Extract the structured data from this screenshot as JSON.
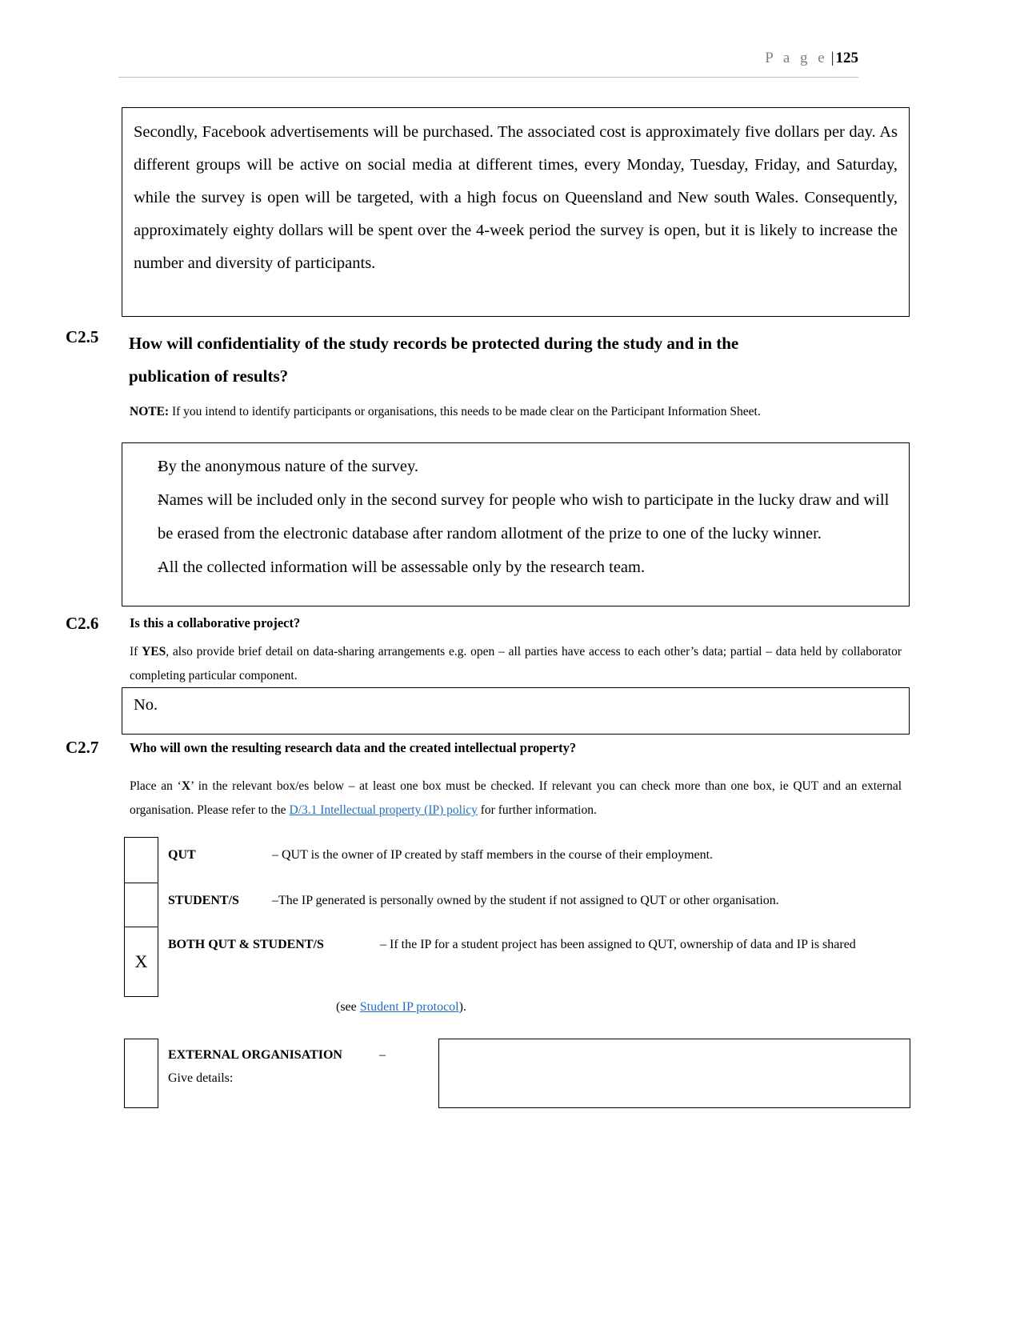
{
  "header": {
    "page_word": "P a g e",
    "separator": "|",
    "page_number": "125"
  },
  "answer_box_1": {
    "text": "Secondly, Facebook advertisements will be purchased. The associated cost is approximately five dollars per day. As different groups will be active on social media at different times, every Monday, Tuesday, Friday, and Saturday, while the survey is open will be targeted, with a high focus on Queensland and New south Wales.  Consequently, approximately eighty dollars will be spent over the 4-week period the survey is open, but it is likely to increase the number and diversity of participants."
  },
  "c25": {
    "number": "C2.5",
    "line1": "How will confidentiality of the study records be protected during the study and in the",
    "line2": "publication of results?",
    "note_label": "NOTE:",
    "note_text": " If you intend to identify participants or organisations, this needs to be made clear on the Participant Information Sheet."
  },
  "answer_box_2": {
    "bullet_mark": "-",
    "bullets": [
      "By the anonymous nature of the survey.",
      "Names will be included only in the second survey for people who wish to participate in the lucky draw and will be erased from the electronic database after random allotment of the prize to one of the lucky winner.",
      "All the collected information will be assessable only by the research team."
    ]
  },
  "c26": {
    "number": "C2.6",
    "heading": "Is this a collaborative project?",
    "helper_prefix": "If ",
    "helper_bold": "YES",
    "helper_rest": ", also provide brief detail on data-sharing arrangements e.g. open – all parties have access to each other’s data; partial – data held by collaborator completing particular component.",
    "answer": "No."
  },
  "c27": {
    "number": "C2.7",
    "heading": "Who will own the resulting research data and the created intellectual property?",
    "instruction_part1": "Place an ‘",
    "instruction_bold_x": "X",
    "instruction_part2": "’ in the relevant box/es below – at least one box must be checked. If relevant you can check more than one box, ie QUT and an external organisation. Please refer to the ",
    "instruction_link": "D/3.1 Intellectual property (IP) policy",
    "instruction_part3": " for further information.",
    "options": [
      {
        "checked": "",
        "name": "QUT",
        "description": "– QUT is the owner of IP created by staff members in the course of their employment."
      },
      {
        "checked": "",
        "name": "STUDENT/S",
        "description": "–The IP generated is personally owned by the student if not assigned to QUT or other organisation."
      },
      {
        "checked": "X",
        "name": "BOTH QUT & STUDENT/S",
        "description": "– If the IP for a student project has been assigned to QUT, ownership of data and IP is shared"
      }
    ],
    "see_prefix": "(see ",
    "see_link": "Student IP protocol",
    "see_suffix": ").",
    "external": {
      "checked": "",
      "name": "EXTERNAL ORGANISATION",
      "dash": "–",
      "give_details": "Give details:",
      "input_value": ""
    }
  },
  "colors": {
    "link": "#1f6fc4",
    "header_gray": "#808080",
    "rule": "#bfbfbf",
    "border": "#000000"
  }
}
